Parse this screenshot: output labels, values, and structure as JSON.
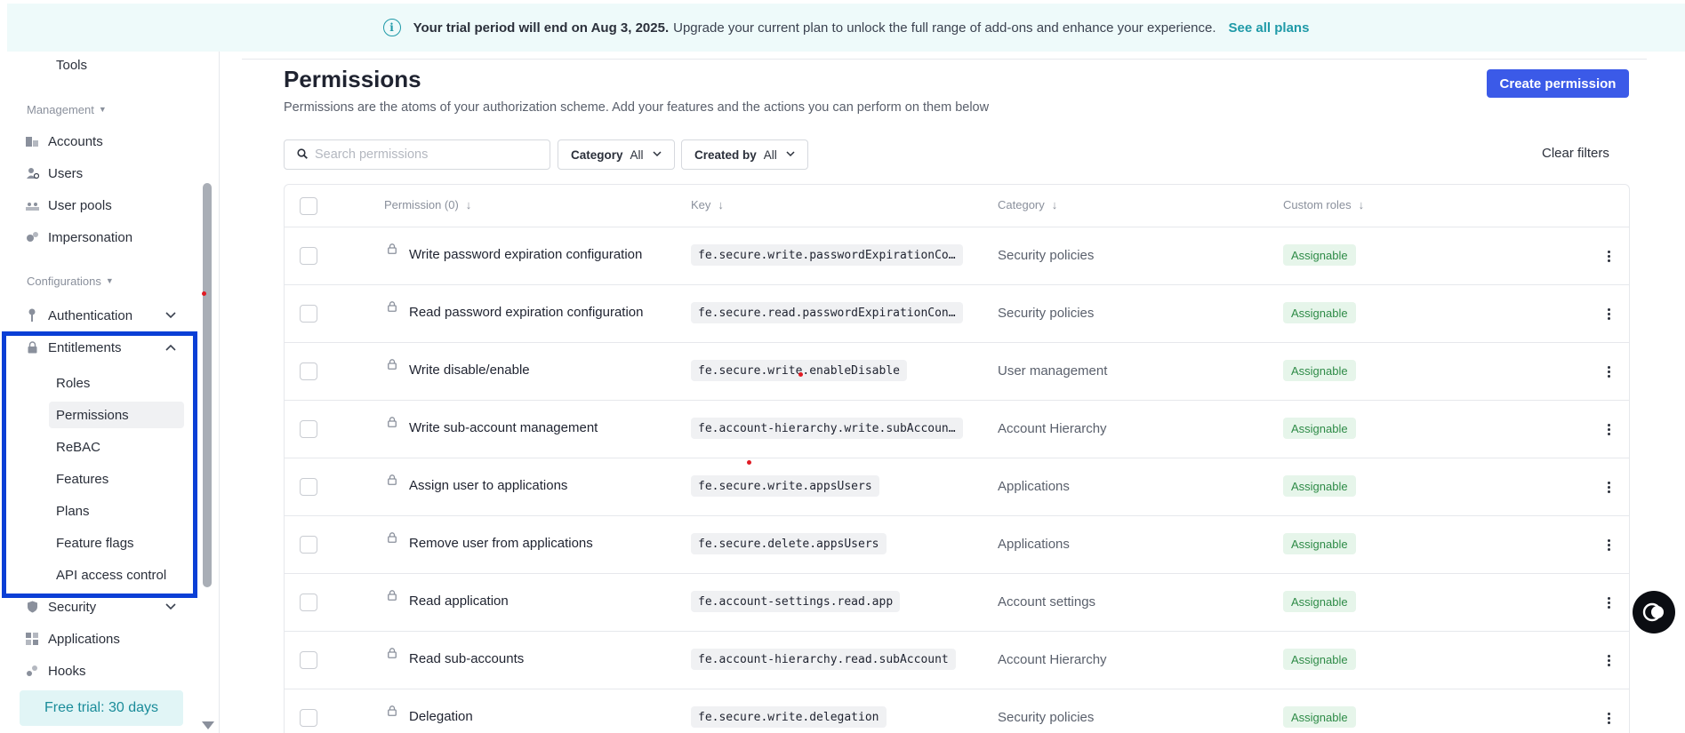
{
  "banner": {
    "bold_text": "Your trial period will end on Aug 3, 2025.",
    "text": "Upgrade your current plan to unlock the full range of add-ons and enhance your experience.",
    "link": "See all plans"
  },
  "sidebar": {
    "partial_item": "Tools",
    "management_header": "Management",
    "management_items": [
      {
        "label": "Accounts",
        "icon": "accounts-icon"
      },
      {
        "label": "Users",
        "icon": "users-icon"
      },
      {
        "label": "User pools",
        "icon": "user-pools-icon"
      },
      {
        "label": "Impersonation",
        "icon": "impersonation-icon"
      }
    ],
    "configurations_header": "Configurations",
    "authentication": "Authentication",
    "entitlements": "Entitlements",
    "entitlements_items": [
      "Roles",
      "Permissions",
      "ReBAC",
      "Features",
      "Plans",
      "Feature flags",
      "API access control"
    ],
    "active_item": "Permissions",
    "security": "Security",
    "applications": "Applications",
    "hooks": "Hooks",
    "trial_button": "Free trial: 30 days"
  },
  "main": {
    "title": "Permissions",
    "description": "Permissions are the atoms of your authorization scheme. Add your features and the actions you can perform on them below",
    "create_button": "Create permission",
    "search_placeholder": "Search permissions",
    "filters": {
      "category_label": "Category",
      "category_value": "All",
      "created_by_label": "Created by",
      "created_by_value": "All"
    },
    "clear_filters": "Clear filters"
  },
  "table": {
    "columns": [
      "Permission (0)",
      "Key",
      "Category",
      "Custom roles"
    ],
    "rows": [
      {
        "name": "Write password expiration configuration",
        "key": "fe.secure.write.passwordExpirationCo…",
        "category": "Security policies",
        "roles": "Assignable"
      },
      {
        "name": "Read password expiration configuration",
        "key": "fe.secure.read.passwordExpirationCon…",
        "category": "Security policies",
        "roles": "Assignable"
      },
      {
        "name": "Write disable/enable",
        "key": "fe.secure.write.enableDisable",
        "category": "User management",
        "roles": "Assignable"
      },
      {
        "name": "Write sub-account management",
        "key": "fe.account-hierarchy.write.subAccoun…",
        "category": "Account Hierarchy",
        "roles": "Assignable"
      },
      {
        "name": "Assign user to applications",
        "key": "fe.secure.write.appsUsers",
        "category": "Applications",
        "roles": "Assignable"
      },
      {
        "name": "Remove user from applications",
        "key": "fe.secure.delete.appsUsers",
        "category": "Applications",
        "roles": "Assignable"
      },
      {
        "name": "Read application",
        "key": "fe.account-settings.read.app",
        "category": "Account settings",
        "roles": "Assignable"
      },
      {
        "name": "Read sub-accounts",
        "key": "fe.account-hierarchy.read.subAccount",
        "category": "Account Hierarchy",
        "roles": "Assignable"
      },
      {
        "name": "Delegation",
        "key": "fe.secure.write.delegation",
        "category": "Security policies",
        "roles": "Assignable"
      }
    ]
  },
  "colors": {
    "accent": "#3b5ae8",
    "banner_bg": "#eefafa",
    "banner_link": "#1f9aa8",
    "badge_text": "#2e8b47",
    "badge_bg": "#e6f5ea",
    "highlight": "#0a3fd6"
  }
}
